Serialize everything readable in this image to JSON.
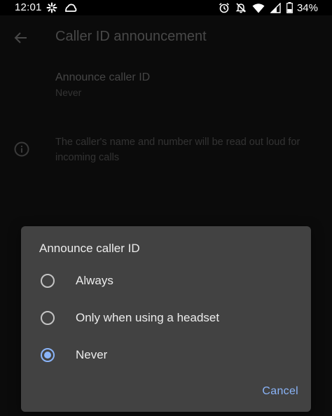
{
  "status_bar": {
    "time": "12:01",
    "battery_percent": "34%",
    "icons": [
      "slack-icon",
      "cloud-icon",
      "alarm-icon",
      "notifications-off-icon",
      "wifi-icon",
      "signal-icon",
      "battery-icon"
    ]
  },
  "app_bar": {
    "title": "Caller ID announcement",
    "back_icon": "arrow-back-icon"
  },
  "preference": {
    "title": "Announce caller ID",
    "summary": "Never"
  },
  "info": {
    "icon": "info-icon",
    "text": "The caller's name and number will be read out loud for incoming calls"
  },
  "dialog": {
    "title": "Announce caller ID",
    "options": [
      {
        "label": "Always",
        "selected": false
      },
      {
        "label": "Only when using a headset",
        "selected": false
      },
      {
        "label": "Never",
        "selected": true
      }
    ],
    "cancel_label": "Cancel"
  },
  "colors": {
    "accent": "#8ab4f8",
    "dialog_background": "#424242",
    "screen_background": "#121212"
  }
}
